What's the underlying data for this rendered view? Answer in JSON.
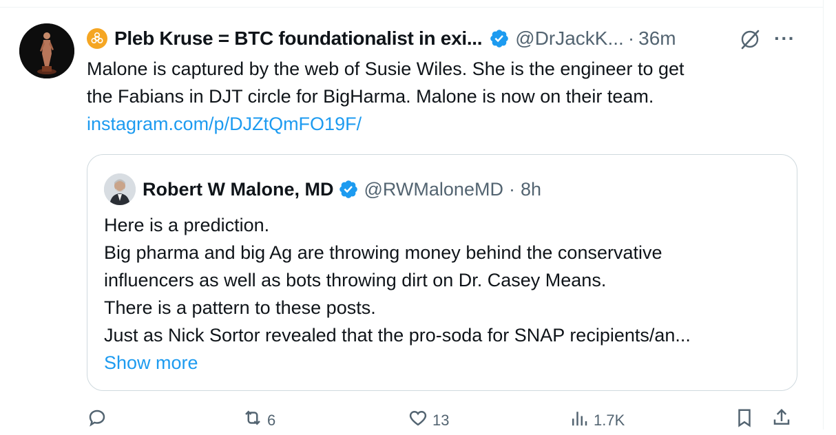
{
  "tweet": {
    "author_name": "Pleb Kruse = BTC foundationalist in exi...",
    "handle": "@DrJackK...",
    "separator": "·",
    "time": "36m",
    "more": "···",
    "text_line1": "Malone is captured by the web of Susie Wiles.  She is the engineer to get",
    "text_line2": "the Fabians in DJT circle for BigHarma.  Malone is now on their team.",
    "link": "instagram.com/p/DJZtQmFO19F/"
  },
  "quote": {
    "author_name": "Robert W Malone, MD",
    "handle": "@RWMaloneMD",
    "separator": "·",
    "time": "8h",
    "lines": [
      "Here is a prediction.",
      "Big pharma and big Ag are throwing money behind the conservative",
      "influencers as well as  bots throwing dirt on Dr. Casey Means.",
      "There is a pattern to these posts.",
      "Just as Nick Sortor revealed that the pro-soda for SNAP recipients/an..."
    ],
    "show_more": "Show more"
  },
  "actions": {
    "retweets": "6",
    "likes": "13",
    "views": "1.7K"
  },
  "colors": {
    "accent": "#1d9bf0",
    "secondary_text": "#536471",
    "border": "#cfd9de",
    "biohazard_badge": "#f5a623"
  }
}
